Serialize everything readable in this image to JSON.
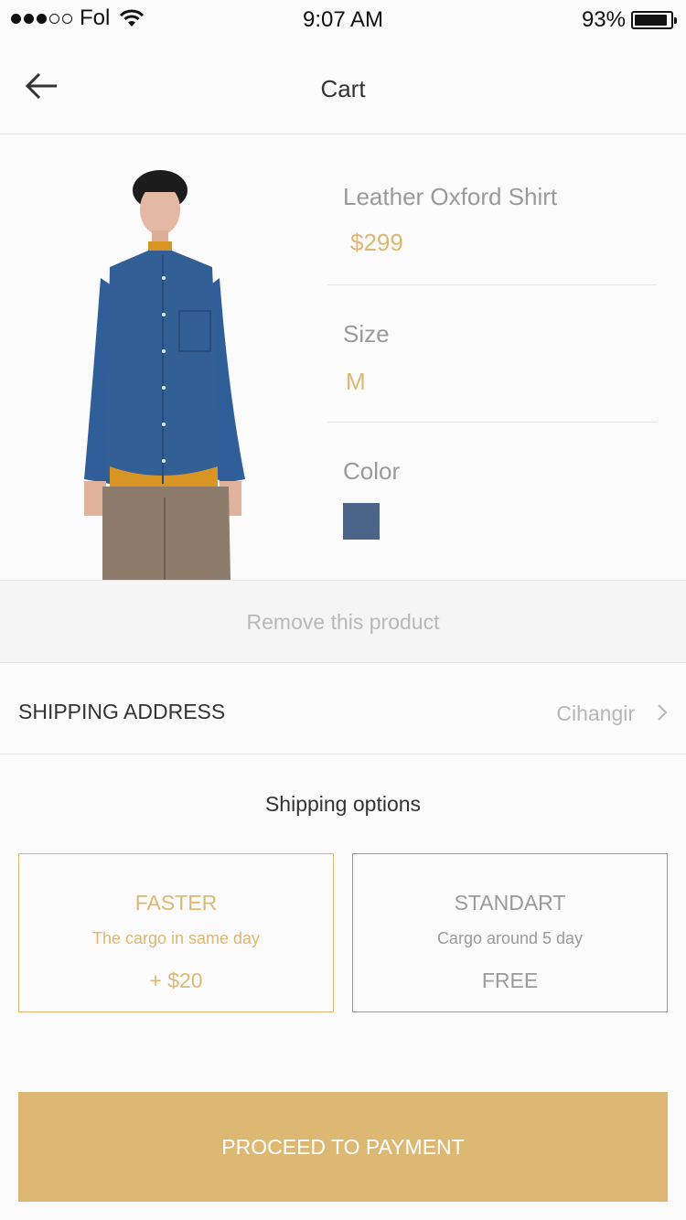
{
  "status_bar": {
    "carrier": "Fol",
    "time": "9:07 AM",
    "battery": "93%",
    "battery_level": 0.93
  },
  "nav": {
    "title": "Cart",
    "back_icon": "arrow-left-icon"
  },
  "product": {
    "name": "Leather Oxford Shirt",
    "price": "$299",
    "size_label": "Size",
    "size_value": "M",
    "color_label": "Color",
    "color_value": "#4b6488"
  },
  "remove_label": "Remove this product",
  "shipping_address": {
    "label": "SHIPPING ADDRESS",
    "value": "Cihangir"
  },
  "shipping_options": {
    "title": "Shipping options",
    "options": [
      {
        "name": "FASTER",
        "description": "The cargo in same day",
        "price": "+ $20",
        "selected": true
      },
      {
        "name": "STANDART",
        "description": "Cargo around 5 day",
        "price": "FREE",
        "selected": false
      }
    ]
  },
  "proceed_label": "PROCEED TO PAYMENT",
  "colors": {
    "accent": "#dcb872",
    "muted": "#9a9a9a"
  }
}
